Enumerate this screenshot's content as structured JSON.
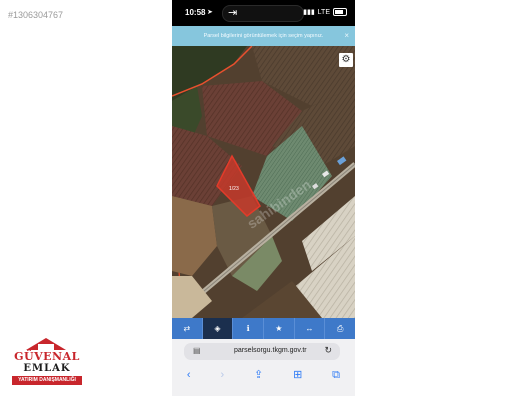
{
  "listing_id": "#1306304767",
  "status_bar": {
    "time": "10:58",
    "location_glyph": "➤",
    "return_glyph": "⇥",
    "network": "LTE",
    "signal_glyph": "▮▮▮",
    "battery_icon": "battery-icon"
  },
  "banner": {
    "text": "Parsel bilgilerini görüntülemek için seçim yapınız.",
    "close_label": "×"
  },
  "map": {
    "parcel_label": "1/23",
    "watermark": "sahibinden",
    "settings_icon": "gear-icon",
    "parcel_color": "#e23b2a",
    "boundary_color": "#e8502e"
  },
  "toolbar": {
    "items": [
      {
        "icon": "⇄",
        "name": "swap"
      },
      {
        "icon": "◈",
        "name": "locate"
      },
      {
        "icon": "ℹ",
        "name": "info"
      },
      {
        "icon": "★",
        "name": "favorite"
      },
      {
        "icon": "↔",
        "name": "measure"
      },
      {
        "icon": "⎙",
        "name": "print"
      }
    ],
    "active_index": 1,
    "color": "#3e79c9"
  },
  "browser": {
    "url": "parselsorgu.tkgm.gov.tr",
    "page_icon": "▤",
    "reload_icon": "↻",
    "nav": {
      "back": "‹",
      "forward": "›",
      "share": "⇪",
      "bookmarks": "⊞",
      "tabs": "⧉"
    }
  },
  "logo": {
    "line1": "GÜVENAL",
    "line2": "EMLAK",
    "line3": "YATIRIM DANIŞMANLIĞI",
    "color": "#c8262c"
  }
}
